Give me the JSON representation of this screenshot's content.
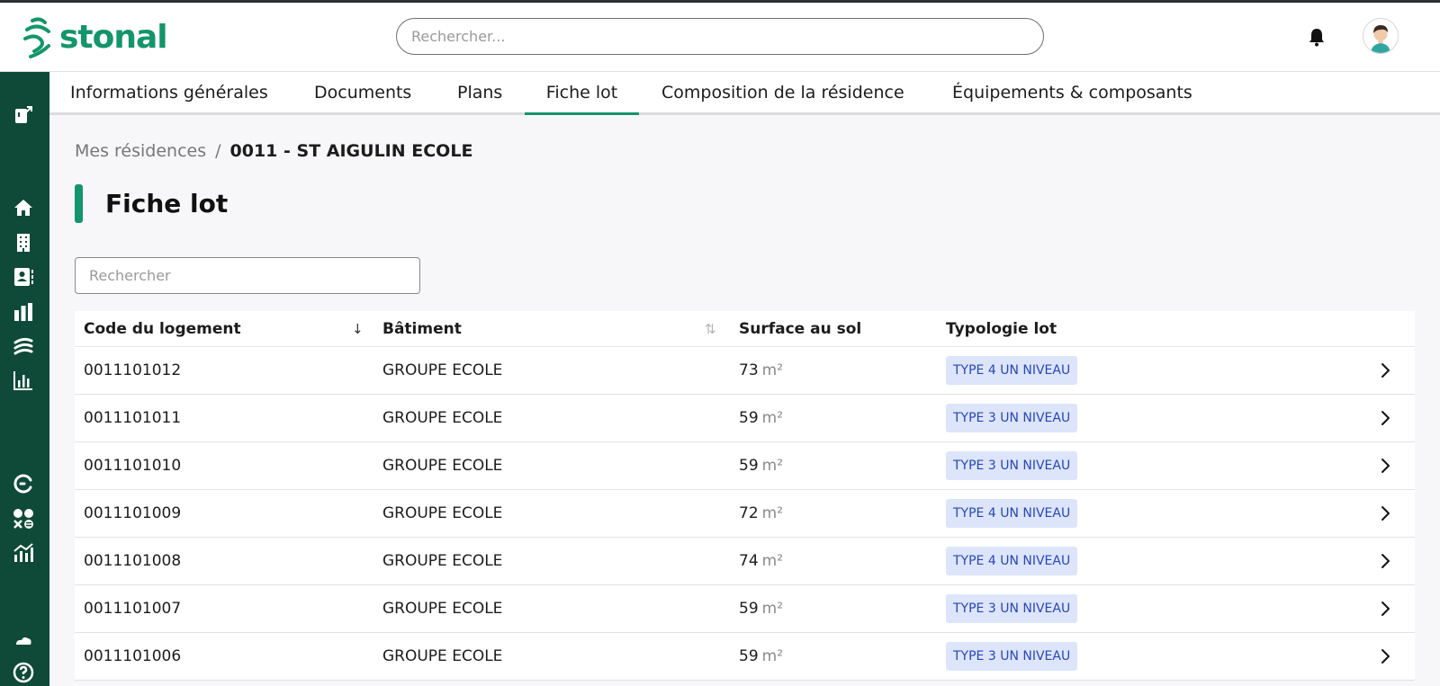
{
  "app": {
    "brand": "stonal",
    "brand_color": "#14956a",
    "sidebar_color": "#0e4a37"
  },
  "header": {
    "search_placeholder": "Rechercher...",
    "bell_icon": "bell-icon",
    "avatar_icon": "user-avatar"
  },
  "sidebar": {
    "items": [
      {
        "icon": "exit-icon"
      },
      {
        "icon": "home-icon"
      },
      {
        "icon": "building-icon"
      },
      {
        "icon": "contacts-icon"
      },
      {
        "icon": "bar-chart-icon"
      },
      {
        "icon": "stonal-signal-icon"
      },
      {
        "icon": "analytics-icon"
      },
      {
        "icon": "refresh-cycle-icon"
      },
      {
        "icon": "calculator-icon"
      },
      {
        "icon": "trend-chart-icon"
      },
      {
        "icon": "cloud-icon"
      },
      {
        "icon": "help-icon"
      }
    ]
  },
  "tabs": [
    {
      "label": "Informations générales",
      "active": false
    },
    {
      "label": "Documents",
      "active": false
    },
    {
      "label": "Plans",
      "active": false
    },
    {
      "label": "Fiche lot",
      "active": true
    },
    {
      "label": "Composition de la résidence",
      "active": false
    },
    {
      "label": "Équipements & composants",
      "active": false
    }
  ],
  "breadcrumb": {
    "parent": "Mes résidences",
    "separator": "/",
    "current": "0011 - ST AIGULIN ECOLE"
  },
  "page": {
    "title": "Fiche lot",
    "search_placeholder": "Rechercher"
  },
  "table": {
    "columns": [
      "Code du logement",
      "Bâtiment",
      "Surface au sol",
      "Typologie lot"
    ],
    "unit": "m²",
    "rows": [
      {
        "code": "0011101012",
        "building": "GROUPE ECOLE",
        "surface": "73",
        "type": "TYPE 4 UN NIVEAU"
      },
      {
        "code": "0011101011",
        "building": "GROUPE ECOLE",
        "surface": "59",
        "type": "TYPE 3 UN NIVEAU"
      },
      {
        "code": "0011101010",
        "building": "GROUPE ECOLE",
        "surface": "59",
        "type": "TYPE 3 UN NIVEAU"
      },
      {
        "code": "0011101009",
        "building": "GROUPE ECOLE",
        "surface": "72",
        "type": "TYPE 4 UN NIVEAU"
      },
      {
        "code": "0011101008",
        "building": "GROUPE ECOLE",
        "surface": "74",
        "type": "TYPE 4 UN NIVEAU"
      },
      {
        "code": "0011101007",
        "building": "GROUPE ECOLE",
        "surface": "59",
        "type": "TYPE 3 UN NIVEAU"
      },
      {
        "code": "0011101006",
        "building": "GROUPE ECOLE",
        "surface": "59",
        "type": "TYPE 3 UN NIVEAU"
      }
    ]
  }
}
